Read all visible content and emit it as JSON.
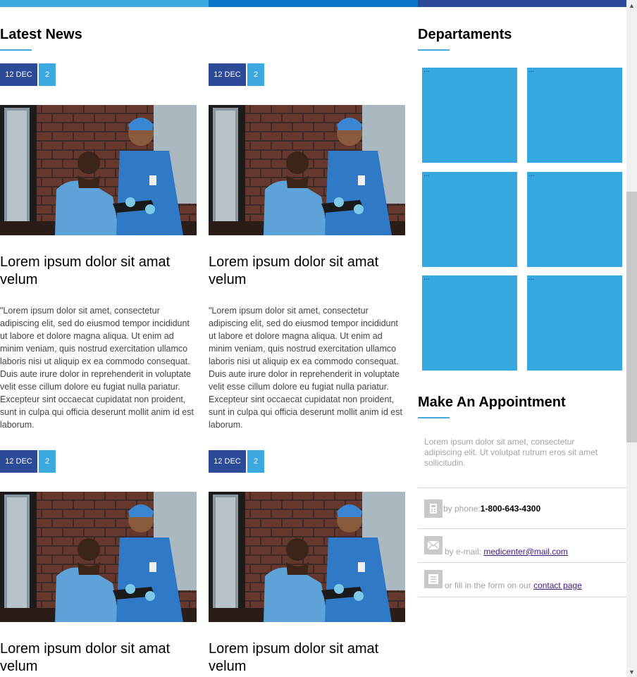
{
  "colors": {
    "accent_light": "#3ba8e0",
    "accent_mid": "#0a77c8",
    "accent_dark": "#2c4a97",
    "department_tile": "#35a8e0"
  },
  "news": {
    "title": "Latest News",
    "items": [
      {
        "date": "12 DEC",
        "count": "2",
        "title": "Lorem ipsum dolor sit amat velum",
        "body": "\"Lorem ipsum dolor sit amet, consectetur adipiscing elit, sed do eiusmod tempor incididunt ut labore et dolore magna aliqua. Ut enim ad minim veniam, quis nostrud exercitation ullamco laboris nisi ut aliquip ex ea commodo consequat. Duis aute irure dolor in reprehenderit in voluptate velit esse cillum dolore eu fugiat nulla pariatur. Excepteur sint occaecat cupidatat non proident, sunt in culpa qui officia deserunt mollit anim id est laborum."
      },
      {
        "date": "12 DEC",
        "count": "2",
        "title": "Lorem ipsum dolor sit amat velum",
        "body": "\"Lorem ipsum dolor sit amet, consectetur adipiscing elit, sed do eiusmod tempor incididunt ut labore et dolore magna aliqua. Ut enim ad minim veniam, quis nostrud exercitation ullamco laboris nisi ut aliquip ex ea commodo consequat. Duis aute irure dolor in reprehenderit in voluptate velit esse cillum dolore eu fugiat nulla pariatur. Excepteur sint occaecat cupidatat non proident, sunt in culpa qui officia deserunt mollit anim id est laborum."
      },
      {
        "date": "12 DEC",
        "count": "2",
        "title": "Lorem ipsum dolor sit amat velum"
      },
      {
        "date": "12 DEC",
        "count": "2",
        "title": "Lorem ipsum dolor sit amat velum"
      }
    ]
  },
  "departments": {
    "title": "Departaments",
    "tiles": [
      "...",
      "...",
      "...",
      "...",
      "...",
      "..."
    ]
  },
  "appointment": {
    "title": "Make An Appointment",
    "text": "Lorem ipsum dolor sit amet, consectetur adipiscing elit. Ut volutpat rutrum eros sit amet sollicitudin.",
    "phone_label": "by phone:",
    "phone": "1-800-643-4300",
    "email_label": "by e-mail:",
    "email": "medicenter@mail.com",
    "form_label": "or fill in the form on our",
    "form_link": "contact page"
  }
}
